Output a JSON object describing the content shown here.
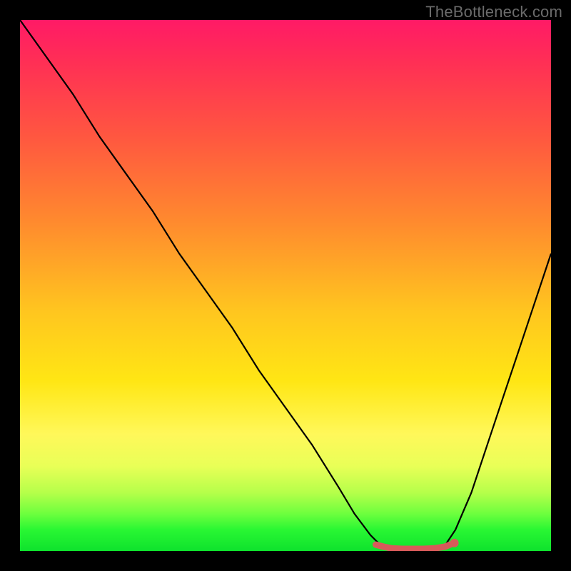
{
  "watermark": "TheBottleneck.com",
  "colors": {
    "background": "#000000",
    "curve": "#000000",
    "marker_fill": "#d85a5a",
    "marker_stroke": "#b84848",
    "watermark_text": "#6b6b6b"
  },
  "chart_data": {
    "type": "line",
    "title": "",
    "xlabel": "",
    "ylabel": "",
    "xlim": [
      0,
      100
    ],
    "ylim": [
      0,
      100
    ],
    "grid": false,
    "legend": false,
    "note": "Axes are implicit percent scales (0–100). Bottleneck curve: high at left, falls to a flat minimum band ~x=68–80, then rises toward the right.",
    "series": [
      {
        "name": "bottleneck_pct",
        "x": [
          0,
          5,
          10,
          15,
          20,
          25,
          30,
          35,
          40,
          45,
          50,
          55,
          60,
          63,
          66,
          68,
          70,
          72,
          74,
          76,
          78,
          80,
          82,
          85,
          88,
          91,
          94,
          97,
          100
        ],
        "values": [
          100,
          93,
          86,
          78,
          71,
          64,
          56,
          49,
          42,
          34,
          27,
          20,
          12,
          7,
          3,
          1,
          0.4,
          0.2,
          0.2,
          0.2,
          0.4,
          1,
          4,
          11,
          20,
          29,
          38,
          47,
          56
        ]
      }
    ],
    "markers": {
      "name": "optimal_band",
      "x": [
        67,
        68.5,
        70,
        72,
        74,
        76,
        78,
        80,
        81
      ],
      "values": [
        1.2,
        0.8,
        0.5,
        0.4,
        0.4,
        0.4,
        0.5,
        0.8,
        1.2
      ]
    }
  }
}
